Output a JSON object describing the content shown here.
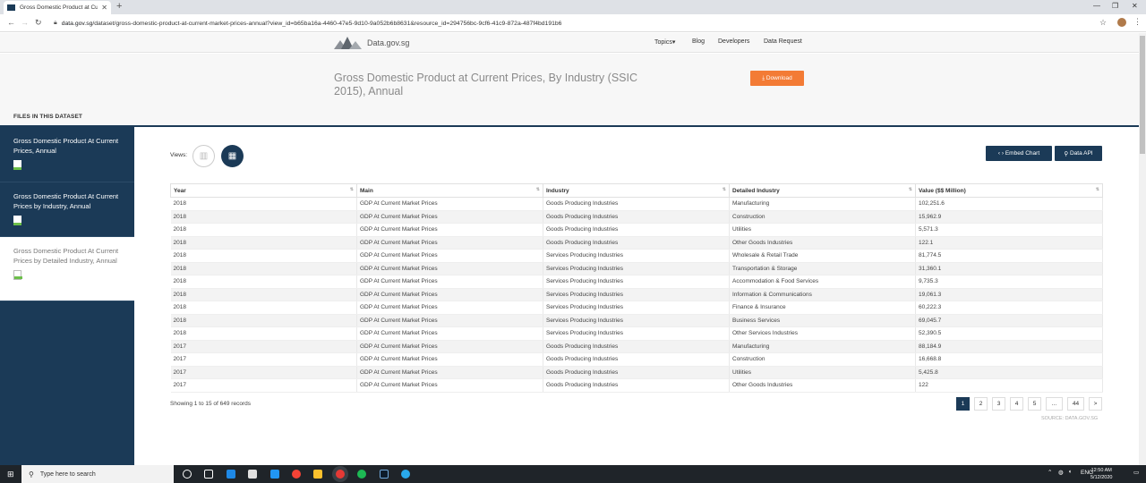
{
  "browser": {
    "tab_title": "Gross Domestic Product at Current",
    "url_host": "data.gov.sg",
    "url_path": "/dataset/gross-domestic-product-at-current-market-prices-annual?view_id=b65ba16a-4460-47e5-9d10-9a052b6b8631&resource_id=294756bc-9cf6-41c9-872a-487f4bd191b6"
  },
  "site": {
    "logo_text": "Data.gov.sg",
    "nav": [
      "Topics",
      "Blog",
      "Developers",
      "Data Request"
    ]
  },
  "dataset": {
    "title": "Gross Domestic Product at Current Prices, By Industry (SSIC 2015), Annual",
    "download_label": "Download",
    "files_label": "FILES IN THIS DATASET"
  },
  "files": [
    {
      "name": "Gross Domestic Product At Current Prices, Annual"
    },
    {
      "name": "Gross Domestic Product At Current Prices by Industry, Annual"
    },
    {
      "name": "Gross Domestic Product At Current Prices by Detailed Industry, Annual"
    }
  ],
  "views": {
    "label": "Views:",
    "embed_label": "Embed Chart",
    "api_label": "Data API"
  },
  "table": {
    "columns": [
      "Year",
      "Main",
      "Industry",
      "Detailed Industry",
      "Value ($$ Million)"
    ],
    "rows": [
      [
        "2018",
        "GDP At Current Market Prices",
        "Goods Producing Industries",
        "Manufacturing",
        "102,251.6"
      ],
      [
        "2018",
        "GDP At Current Market Prices",
        "Goods Producing Industries",
        "Construction",
        "15,962.9"
      ],
      [
        "2018",
        "GDP At Current Market Prices",
        "Goods Producing Industries",
        "Utilities",
        "5,571.3"
      ],
      [
        "2018",
        "GDP At Current Market Prices",
        "Goods Producing Industries",
        "Other Goods Industries",
        "122.1"
      ],
      [
        "2018",
        "GDP At Current Market Prices",
        "Services Producing Industries",
        "Wholesale & Retail Trade",
        "81,774.5"
      ],
      [
        "2018",
        "GDP At Current Market Prices",
        "Services Producing Industries",
        "Transportation & Storage",
        "31,360.1"
      ],
      [
        "2018",
        "GDP At Current Market Prices",
        "Services Producing Industries",
        "Accommodation & Food Services",
        "9,735.3"
      ],
      [
        "2018",
        "GDP At Current Market Prices",
        "Services Producing Industries",
        "Information & Communications",
        "19,061.3"
      ],
      [
        "2018",
        "GDP At Current Market Prices",
        "Services Producing Industries",
        "Finance & Insurance",
        "60,222.3"
      ],
      [
        "2018",
        "GDP At Current Market Prices",
        "Services Producing Industries",
        "Business Services",
        "69,045.7"
      ],
      [
        "2018",
        "GDP At Current Market Prices",
        "Services Producing Industries",
        "Other Services Industries",
        "52,390.5"
      ],
      [
        "2017",
        "GDP At Current Market Prices",
        "Goods Producing Industries",
        "Manufacturing",
        "88,184.9"
      ],
      [
        "2017",
        "GDP At Current Market Prices",
        "Goods Producing Industries",
        "Construction",
        "16,668.8"
      ],
      [
        "2017",
        "GDP At Current Market Prices",
        "Goods Producing Industries",
        "Utilities",
        "5,425.8"
      ],
      [
        "2017",
        "GDP At Current Market Prices",
        "Goods Producing Industries",
        "Other Goods Industries",
        "122"
      ]
    ],
    "records_text": "Showing 1 to 15 of 649 records",
    "pages": [
      "1",
      "2",
      "3",
      "4",
      "5",
      "...",
      "44",
      ">"
    ],
    "source_text": "SOURCE: DATA.GOV.SG"
  },
  "taskbar": {
    "search_placeholder": "Type here to search",
    "lang": "ENG",
    "time": "12:50 AM",
    "date": "5/12/2020"
  },
  "colors": {
    "navy": "#1b3a57",
    "orange": "#f37b35"
  }
}
